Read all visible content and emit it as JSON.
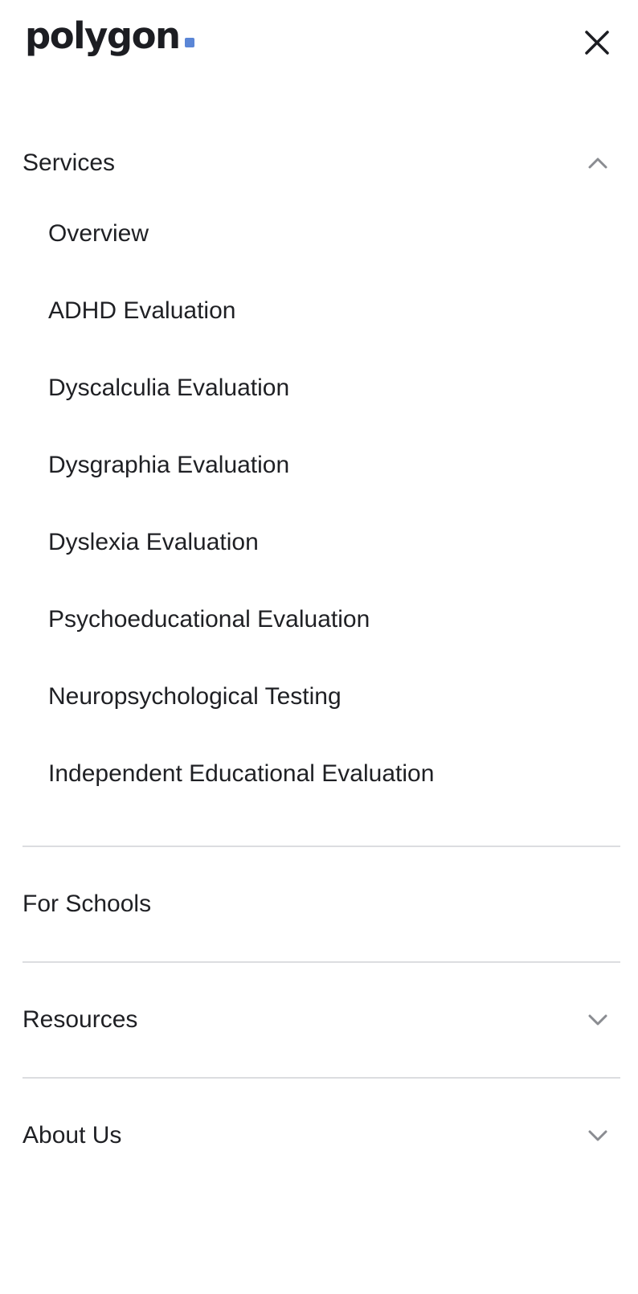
{
  "brand": {
    "logo_text": "polygon",
    "accent_color": "#5b86d6"
  },
  "header": {
    "close_icon": "close-icon"
  },
  "menu": {
    "services": {
      "label": "Services",
      "expanded": true,
      "icon": "chevron-up-icon",
      "items": [
        {
          "label": "Overview"
        },
        {
          "label": "ADHD Evaluation"
        },
        {
          "label": "Dyscalculia Evaluation"
        },
        {
          "label": "Dysgraphia Evaluation"
        },
        {
          "label": "Dyslexia Evaluation"
        },
        {
          "label": "Psychoeducational Evaluation"
        },
        {
          "label": "Neuropsychological Testing"
        },
        {
          "label": "Independent Educational Evaluation"
        }
      ]
    },
    "for_schools": {
      "label": "For Schools"
    },
    "resources": {
      "label": "Resources",
      "expanded": false,
      "icon": "chevron-down-icon"
    },
    "about_us": {
      "label": "About Us",
      "expanded": false,
      "icon": "chevron-down-icon"
    }
  }
}
